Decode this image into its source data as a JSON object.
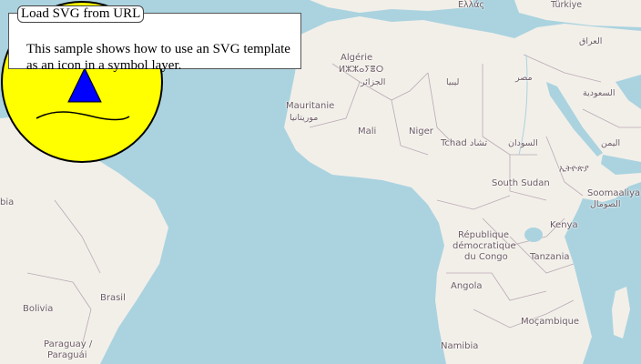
{
  "panel": {
    "title": "Load SVG from URL",
    "description": "This sample shows how to use an SVG template as an icon in a symbol layer."
  },
  "map": {
    "labels": [
      {
        "id": "ellas",
        "text": "Ελλάς"
      },
      {
        "id": "turkiye",
        "text": "Türkiye"
      },
      {
        "id": "iraq",
        "text": "العراق"
      },
      {
        "id": "algerie",
        "text": "Algérie"
      },
      {
        "id": "algerie_tifinagh",
        "text": "ⵍⵣⵣⴰⵢⴻⵔ"
      },
      {
        "id": "algerie_ar",
        "text": "الجزائر"
      },
      {
        "id": "libya",
        "text": "ليبيا"
      },
      {
        "id": "misr",
        "text": "مصر"
      },
      {
        "id": "saudi",
        "text": "السعودية"
      },
      {
        "id": "mauritanie",
        "text": "Mauritanie"
      },
      {
        "id": "mauritanie_ar",
        "text": "موريتانيا"
      },
      {
        "id": "mali",
        "text": "Mali"
      },
      {
        "id": "niger",
        "text": "Niger"
      },
      {
        "id": "tchad",
        "text": "Tchad تشاد"
      },
      {
        "id": "sudan",
        "text": "السودان"
      },
      {
        "id": "yemen",
        "text": "اليمن"
      },
      {
        "id": "ethiopia",
        "text": "ኢትዮጵያ"
      },
      {
        "id": "south_sudan",
        "text": "South Sudan"
      },
      {
        "id": "soomaaliya",
        "text": "Soomaaliya"
      },
      {
        "id": "somalia_ar",
        "text": "الصومال"
      },
      {
        "id": "kenya",
        "text": "Kenya"
      },
      {
        "id": "rdc1",
        "text": "République"
      },
      {
        "id": "rdc2",
        "text": "démocratique"
      },
      {
        "id": "rdc3",
        "text": "du Congo"
      },
      {
        "id": "tanzania",
        "text": "Tanzania"
      },
      {
        "id": "angola",
        "text": "Angola"
      },
      {
        "id": "mocambique",
        "text": "Moçambique"
      },
      {
        "id": "namibia",
        "text": "Namibia"
      },
      {
        "id": "brasil",
        "text": "Brasil"
      },
      {
        "id": "bolivia",
        "text": "Bolivia"
      },
      {
        "id": "paraguay",
        "text": "Paraguay /"
      },
      {
        "id": "paraguai",
        "text": "Paraguái"
      },
      {
        "id": "via",
        "text": "bia"
      }
    ]
  },
  "marker": {
    "icon": "smiley-face-icon",
    "face_color": "#ffff00",
    "eye_color": "#cccc00",
    "nose_color": "#0000ff",
    "stroke_color": "#000000"
  },
  "colors": {
    "water": "#aad3df",
    "land": "#f2efe9",
    "border": "#b9a9b4"
  }
}
